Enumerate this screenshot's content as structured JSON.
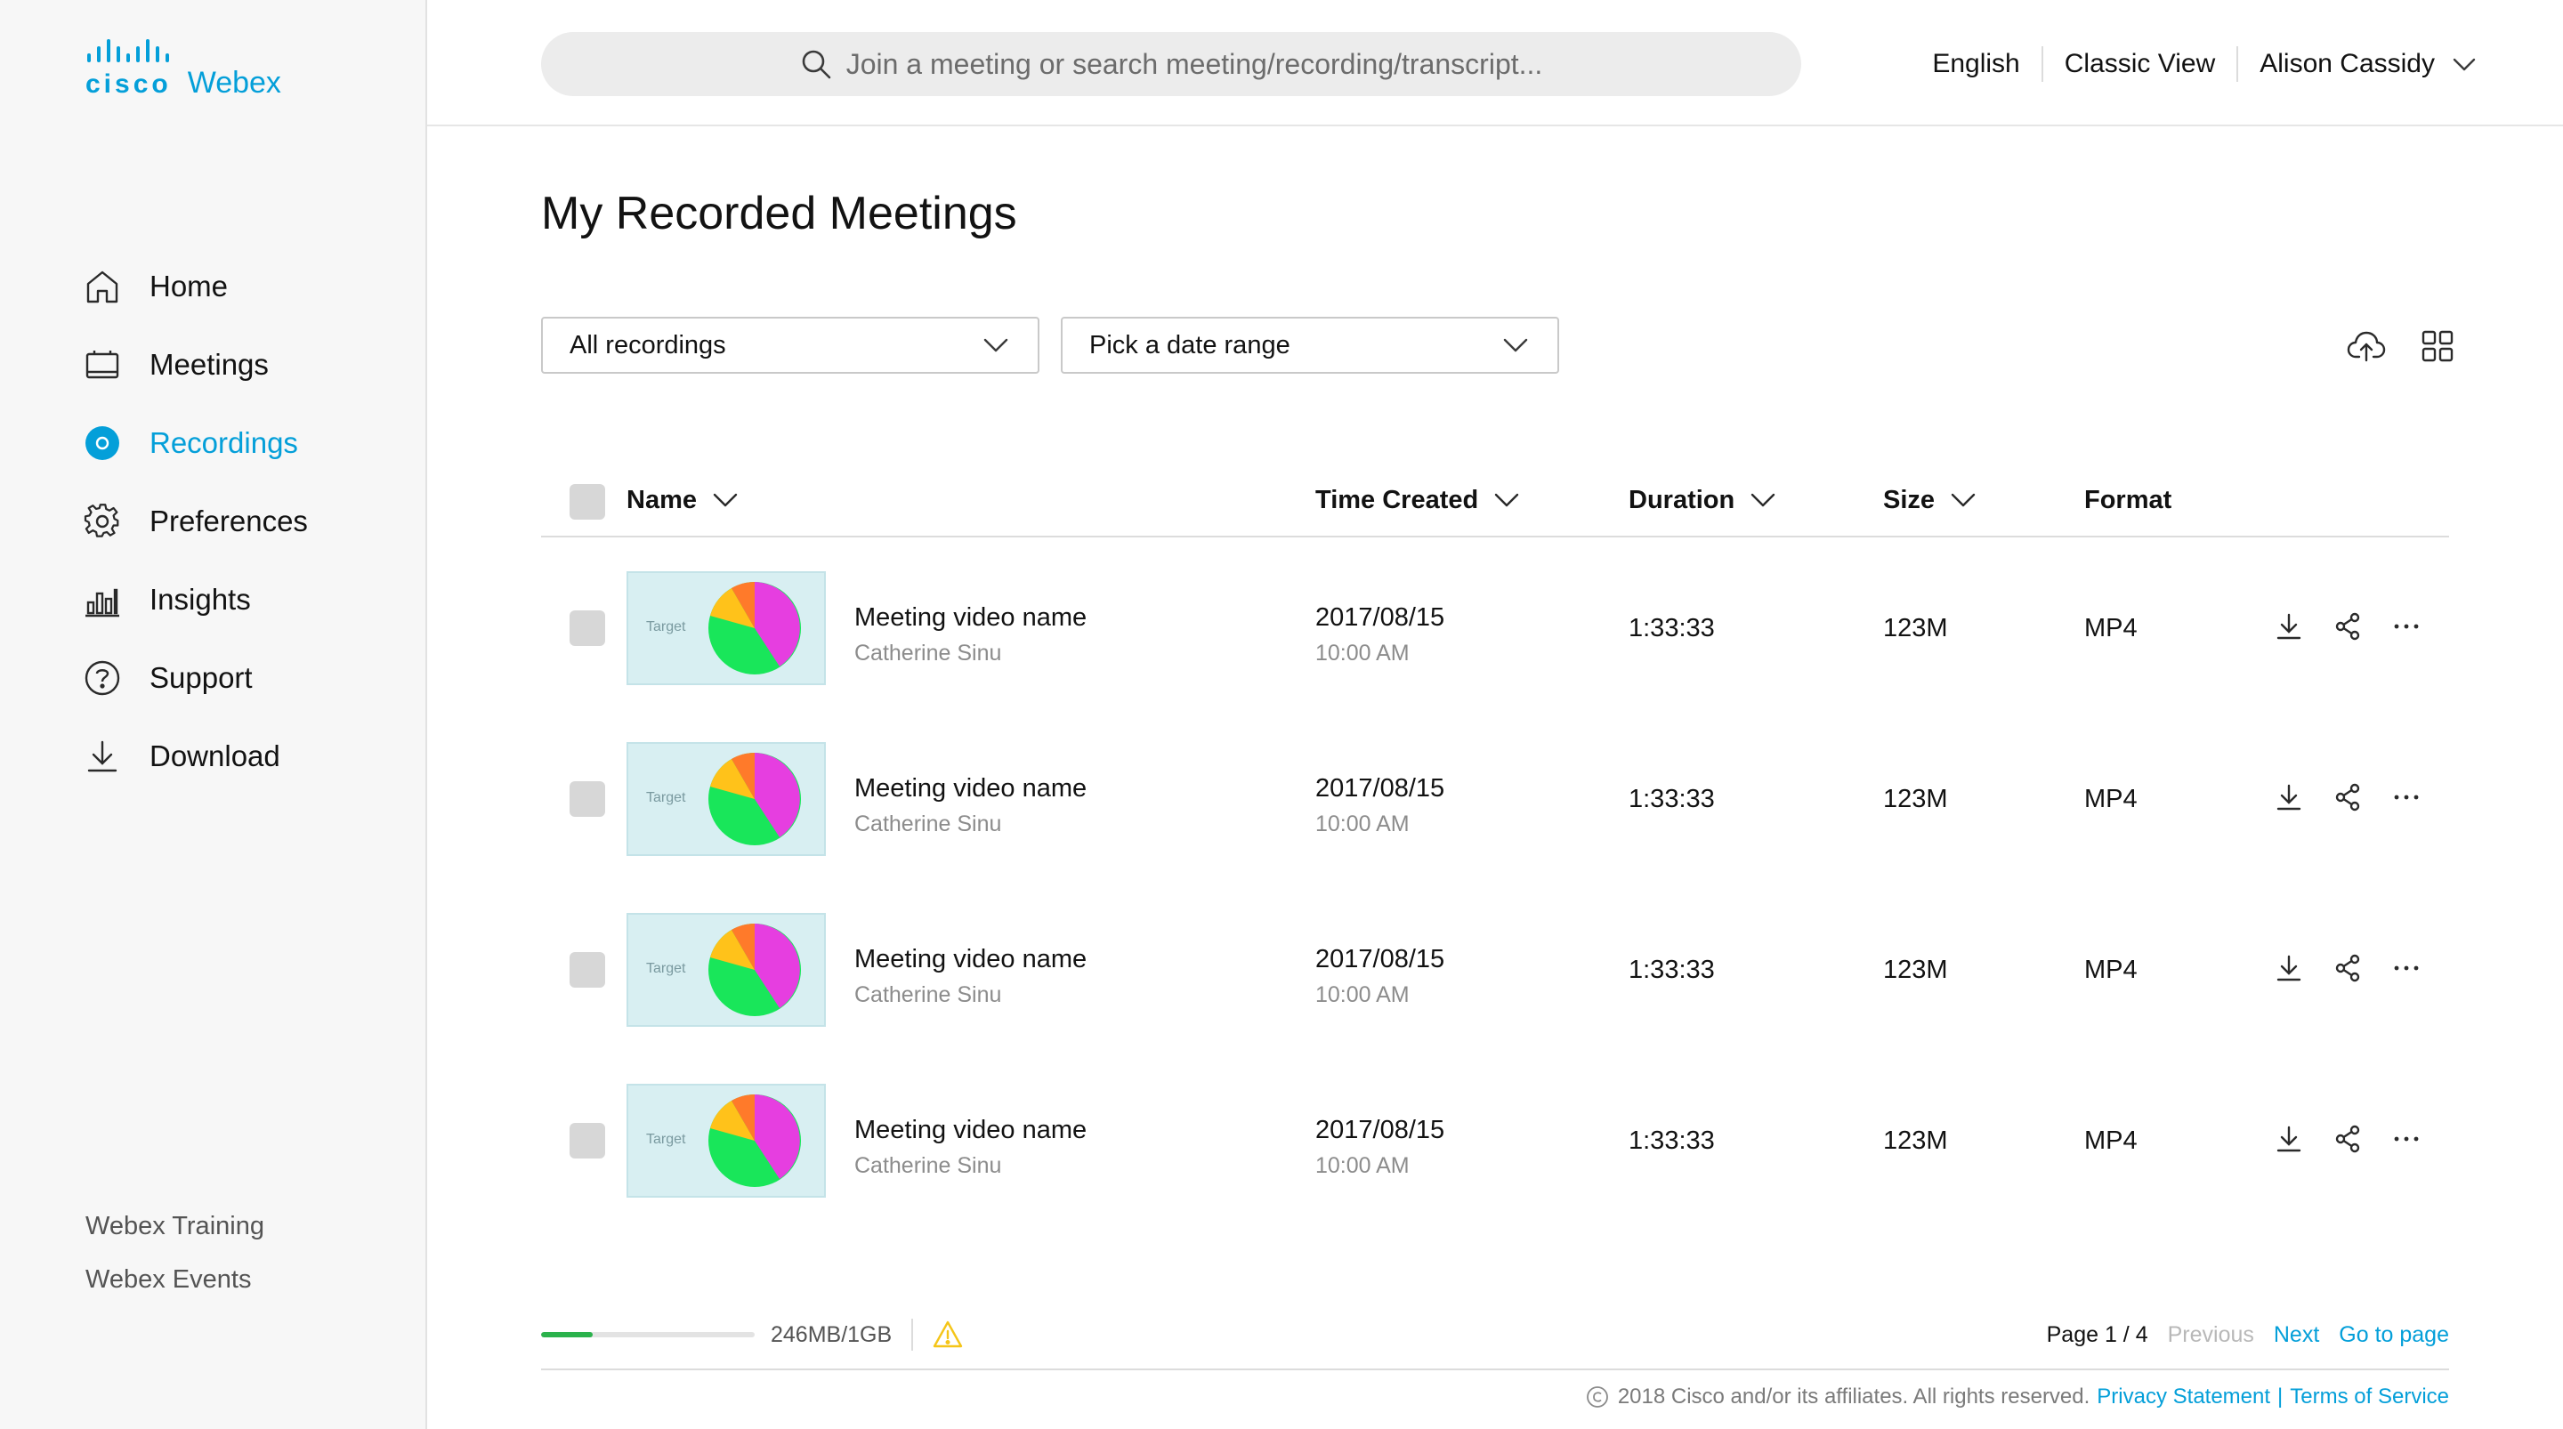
{
  "brand": {
    "cisco": "cisco",
    "product": "Webex",
    "color": "#049fd9"
  },
  "search": {
    "placeholder": "Join a meeting or search meeting/recording/transcript..."
  },
  "header": {
    "language": "English",
    "classic_view": "Classic View",
    "user_name": "Alison Cassidy"
  },
  "sidebar": {
    "items": [
      {
        "label": "Home",
        "icon": "home-icon",
        "active": false
      },
      {
        "label": "Meetings",
        "icon": "meetings-icon",
        "active": false
      },
      {
        "label": "Recordings",
        "icon": "recordings-icon",
        "active": true
      },
      {
        "label": "Preferences",
        "icon": "gear-icon",
        "active": false
      },
      {
        "label": "Insights",
        "icon": "insights-icon",
        "active": false
      },
      {
        "label": "Support",
        "icon": "help-icon",
        "active": false
      },
      {
        "label": "Download",
        "icon": "download-icon",
        "active": false
      }
    ],
    "links": [
      "Webex Training",
      "Webex Events"
    ]
  },
  "page": {
    "title": "My Recorded Meetings"
  },
  "filters": {
    "recordings_filter": "All recordings",
    "date_range": "Pick a date range"
  },
  "table": {
    "columns": {
      "name": "Name",
      "time_created": "Time Created",
      "duration": "Duration",
      "size": "Size",
      "format": "Format"
    },
    "rows": [
      {
        "thumb_label": "Target",
        "name": "Meeting video name",
        "host": "Catherine Sinu",
        "date": "2017/08/15",
        "time": "10:00 AM",
        "duration": "1:33:33",
        "size": "123M",
        "format": "MP4"
      },
      {
        "thumb_label": "Target",
        "name": "Meeting video name",
        "host": "Catherine Sinu",
        "date": "2017/08/15",
        "time": "10:00 AM",
        "duration": "1:33:33",
        "size": "123M",
        "format": "MP4"
      },
      {
        "thumb_label": "Target",
        "name": "Meeting video name",
        "host": "Catherine Sinu",
        "date": "2017/08/15",
        "time": "10:00 AM",
        "duration": "1:33:33",
        "size": "123M",
        "format": "MP4"
      },
      {
        "thumb_label": "Target",
        "name": "Meeting video name",
        "host": "Catherine Sinu",
        "date": "2017/08/15",
        "time": "10:00 AM",
        "duration": "1:33:33",
        "size": "123M",
        "format": "MP4"
      }
    ]
  },
  "storage": {
    "used_text": "246MB/1GB",
    "used_fraction": 0.24,
    "bar_color": "#2bb24c",
    "warning_color": "#f5c518"
  },
  "pagination": {
    "page_label": "Page 1 / 4",
    "previous": "Previous",
    "next": "Next",
    "go_to_page": "Go to page"
  },
  "footer": {
    "copyright": "2018 Cisco and/or its affiliates. All rights reserved.",
    "privacy": "Privacy Statement",
    "separator": "|",
    "terms": "Terms of Service"
  }
}
